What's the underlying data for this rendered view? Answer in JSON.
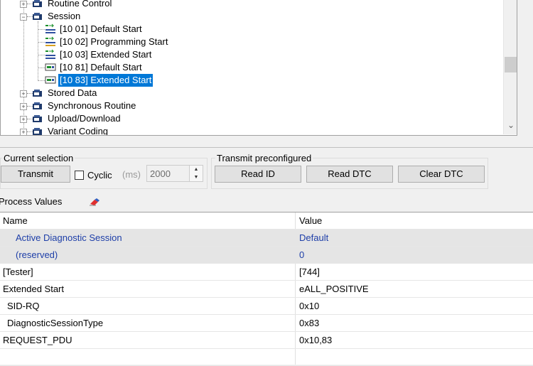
{
  "tree": {
    "items": [
      {
        "label": "Routine Control",
        "expander": "+"
      },
      {
        "label": "Session",
        "expander": "−"
      },
      {
        "label": "[10 01] Default Start"
      },
      {
        "label": "[10 02] Programming Start"
      },
      {
        "label": "[10 03] Extended Start"
      },
      {
        "label": "[10 81] Default Start"
      },
      {
        "label": "[10 83] Extended Start",
        "selected": true
      },
      {
        "label": "Stored Data",
        "expander": "+"
      },
      {
        "label": "Synchronous Routine",
        "expander": "+"
      },
      {
        "label": "Upload/Download",
        "expander": "+"
      },
      {
        "label": "Variant Coding",
        "expander": "+"
      }
    ]
  },
  "current_selection": {
    "title": "Current selection",
    "transmit_label": "Transmit",
    "cyclic_label": "Cyclic",
    "ms_label": "(ms)",
    "interval_value": "2000"
  },
  "transmit_preconfigured": {
    "title": "Transmit preconfigured",
    "read_id_label": "Read ID",
    "read_dtc_label": "Read DTC",
    "clear_dtc_label": "Clear DTC"
  },
  "process_values": {
    "title": "Process Values",
    "columns": {
      "name": "Name",
      "value": "Value"
    },
    "rows": [
      {
        "name": "Active Diagnostic Session",
        "value": "Default"
      },
      {
        "name": "(reserved)",
        "value": "0"
      },
      {
        "name": "[Tester]",
        "value": "[744]"
      },
      {
        "name": "Extended Start",
        "value": "eALL_POSITIVE"
      },
      {
        "name": "SID-RQ",
        "value": "0x10"
      },
      {
        "name": "DiagnosticSessionType",
        "value": "0x83"
      },
      {
        "name": "REQUEST_PDU",
        "value": "0x10,83"
      }
    ]
  },
  "colors": {
    "selection": "#0078d7",
    "highlight_text": "#1d3ea8"
  }
}
